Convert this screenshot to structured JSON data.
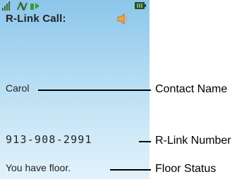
{
  "screen": {
    "title": "R-Link Call:",
    "contact_name": "Carol",
    "rlink_number": "913-908-2991",
    "floor_status": "You have floor.",
    "icons": {
      "signal": "signal-strength-icon",
      "status1": "network-status-icon",
      "status2": "ptt-status-icon",
      "battery": "battery-icon",
      "speaker": "speaker-icon"
    },
    "colors": {
      "screen_top": "#8cc6ea",
      "screen_bottom": "#e2f2fb",
      "speaker": "#e8a64a"
    }
  },
  "callouts": {
    "contact_name": "Contact Name",
    "rlink_number": "R-Link Number",
    "floor_status": "Floor Status"
  }
}
